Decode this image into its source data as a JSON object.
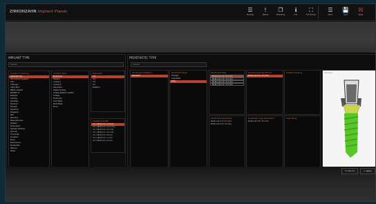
{
  "app": {
    "brand": "ZIRKONZAHN",
    "product": ".Implant Planer"
  },
  "toolbar": [
    {
      "icon": "list-icon",
      "glyph": "☰",
      "label": "Preview"
    },
    {
      "icon": "alert-icon",
      "glyph": "!",
      "label": "Status"
    },
    {
      "icon": "copy-icon",
      "glyph": "❐",
      "label": "Modelling"
    },
    {
      "icon": "info-icon",
      "glyph": "ℹ",
      "label": "Info"
    },
    {
      "icon": "fullscreen-icon",
      "glyph": "⛶",
      "label": "Full Screen"
    }
  ],
  "toolbar_right": [
    {
      "icon": "menu-icon",
      "glyph": "☰",
      "label": "Menu"
    },
    {
      "icon": "save-icon",
      "glyph": "💾",
      "label": "Save"
    },
    {
      "icon": "close-icon",
      "glyph": "☒",
      "label": "Close",
      "red": true
    }
  ],
  "implant_panel": {
    "title": "IMPLANT TYPE",
    "search_placeholder": "Search",
    "columns": [
      {
        "header": "Implant Company",
        "items": [
          "Alpha-Bio Tec",
          "3M Implant Systems",
          "Adin",
          "Anthogyr",
          "Astra Tech",
          "BEGO Implant",
          "BIOMET 3i",
          "Bredent",
          "Camlog",
          "Dentsply",
          "Dentium",
          "Hiossen",
          "Keystone",
          "MegaGen",
          "MIS",
          "Neodent",
          "Nobel Biocare",
          "Osstem",
          "Straumann",
          "Sweden Martina",
          "Zimmer",
          "Thommen",
          "Southern",
          "Bicon",
          "Biohorizons",
          "Medentika",
          "Ziterion",
          "Other"
        ],
        "selected": 0
      },
      {
        "header": "Implant Type",
        "items": [
          "Multi-Unit",
          "Implant",
          "Analog L",
          "Analog S",
          "Abutment",
          "Digital Analog",
          "Analog Platform Switch",
          "Ti-Base",
          "Scanbody",
          "Gold Base",
          "Multi Base",
          "Mono"
        ],
        "selected": 0
      },
      {
        "header": "Diameter",
        "items": [
          "3.5",
          "4.0",
          "4.5",
          "5.0",
          "Platform"
        ],
        "selected": 0
      }
    ],
    "lengths": {
      "header": "Implant Length",
      "items": [
        "3.5 / NP Ø 3.5 L 10 mm",
        "3.5 / NP Ø 3.5 L 11.5 mm",
        "3.5 / NP Ø 3.5 L 13 mm",
        "3.5 / NP Ø 3.5 L 15 mm",
        "3.5 / NP Ø 3.5 L 8 mm",
        "3.5 / NP Ø 3.5 L 7 mm",
        "3.5 / NP Ø 3.5 L 9 mm"
      ],
      "selected": 0
    }
  },
  "prosthetic_panel": {
    "title": "PROSTHETIC TYPE",
    "search_placeholder": "Search",
    "columns": [
      {
        "header": "Abutment Category",
        "items": [
          "Standard"
        ],
        "selected": 0
      },
      {
        "header": "Abutment Type",
        "items": [
          "Straight",
          "Angulated",
          "Base"
        ],
        "selected": 2
      },
      {
        "header": "Abutment Size",
        "items": [
          "Multi-unit 2.5 / 3.5 mm",
          "Multi-unit 2.5 / 3.5 mm",
          "Multi-unit 1.5 / 3.5 mm",
          "Multi-unit 2.5 / 3.5 mm"
        ],
        "selected": 0,
        "boxed": true
      },
      {
        "header": "Screw-Level Abutment",
        "items": [
          "Multi-unit 2.5 / 3.5 mm"
        ],
        "selected": 0
      },
      {
        "header": "Implant Analog",
        "items": [],
        "selected": -1
      }
    ],
    "lower": [
      {
        "header": "Abutment Abutment",
        "items": [
          "Multi-unit 2.5 / 3.5 mm",
          "Multi-unit 2.5 / 3.5 mm"
        ]
      },
      {
        "header": "Prosthetic Cap Abutment",
        "items": [
          "Multi-unit 3.5 / 3.5 mm"
        ]
      },
      {
        "header": "Scan Body",
        "items": []
      }
    ],
    "viewer_label": "Preview"
  },
  "footer": {
    "cancel_label": "Cancel",
    "apply_label": "Apply"
  },
  "colors": {
    "accent": "#e06a3a",
    "selected": "#b8412c",
    "implant_green": "#58c528"
  }
}
